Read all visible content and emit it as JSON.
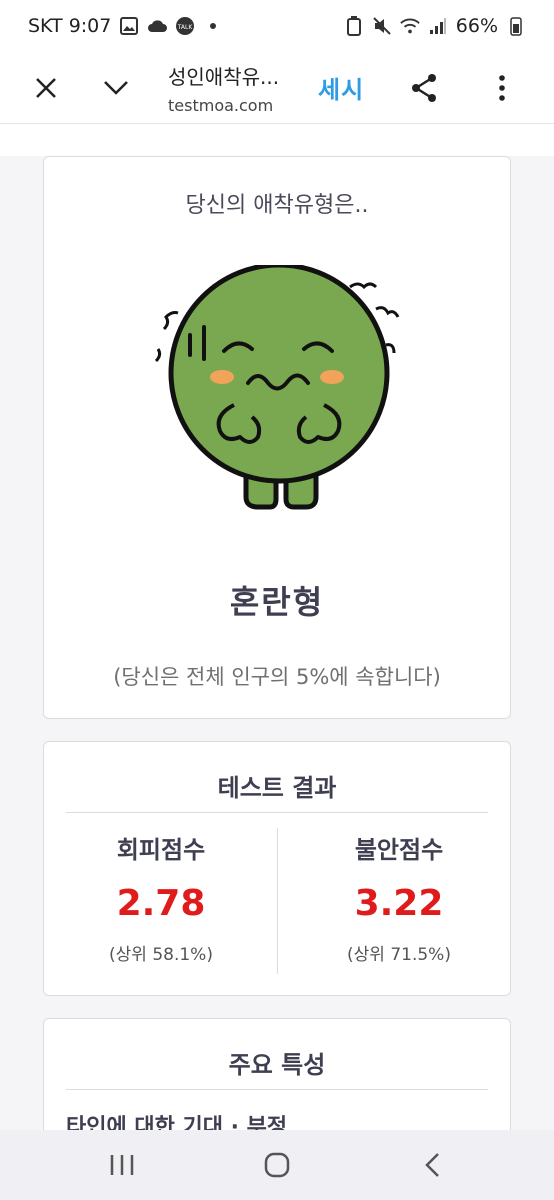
{
  "status_bar": {
    "carrier_time": "SKT 9:07",
    "talk_badge": "TALK",
    "battery_percent": "66%"
  },
  "toolbar": {
    "page_title": "성인애착유...",
    "domain": "testmoa.com",
    "sesi_label": "세시"
  },
  "result": {
    "subtitle": "당신의 애착유형은..",
    "type_name": "혼란형",
    "population_note": "(당신은 전체 인구의 5%에 속합니다)"
  },
  "scores": {
    "title": "테스트 결과",
    "avoidance": {
      "label": "회피점수",
      "value": "2.78",
      "rank": "(상위 58.1%)"
    },
    "anxiety": {
      "label": "불안점수",
      "value": "3.22",
      "rank": "(상위 71.5%)"
    }
  },
  "traits": {
    "title": "주요 특성",
    "first_item": "타인에 대한 기대 · 부정"
  },
  "colors": {
    "accent_blue": "#2d9be6",
    "score_red": "#e01b1b",
    "character_green": "#7aa850"
  }
}
